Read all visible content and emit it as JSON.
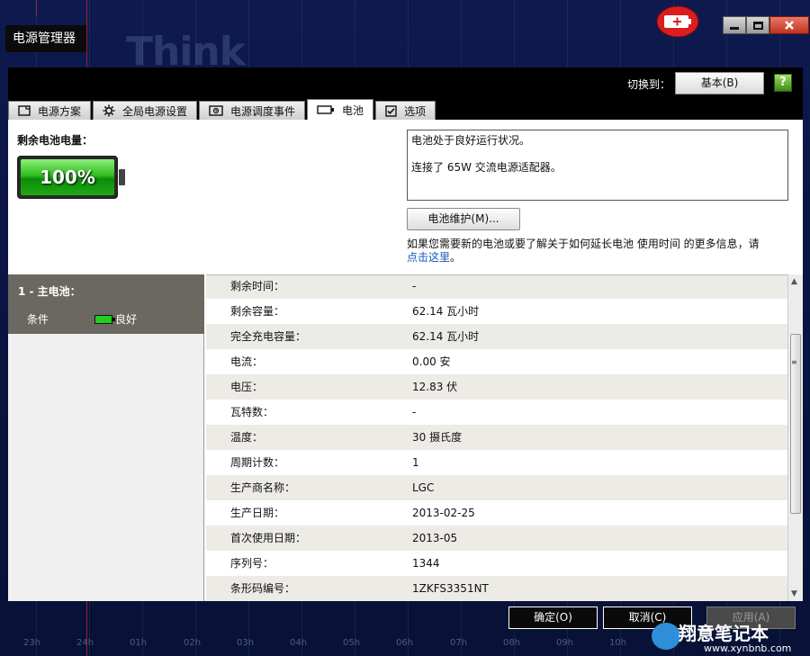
{
  "window": {
    "title": "电源管理器",
    "logo_text": "Think"
  },
  "header": {
    "switch_label": "切换到：",
    "basic_button": "基本(B)",
    "help_icon": "?"
  },
  "tabs": [
    {
      "label": "电源方案",
      "icon": "power-plan-icon"
    },
    {
      "label": "全局电源设置",
      "icon": "gear-icon"
    },
    {
      "label": "电源调度事件",
      "icon": "schedule-icon"
    },
    {
      "label": "电池",
      "icon": "battery-icon",
      "active": true
    },
    {
      "label": "选项",
      "icon": "checkbox-icon"
    }
  ],
  "battery_summary": {
    "remaining_label": "剩余电池电量：",
    "percent_text": "100%",
    "charge_level": 1.0,
    "status_line_1": "电池处于良好运行状况。",
    "status_line_2": "连接了 65W 交流电源适配器。",
    "maintenance_button": "电池维护(M)...",
    "info_text": "如果您需要新的电池或要了解关于如何延长电池 使用时间 的更多信息，请",
    "info_link": "点击这里",
    "info_suffix": "。"
  },
  "battery_list": {
    "name": "1 - 主电池：",
    "condition_label": "条件",
    "condition_value": "良好"
  },
  "details": [
    {
      "key": "剩余时间：",
      "value": "-"
    },
    {
      "key": "剩余容量：",
      "value": "62.14 瓦小时"
    },
    {
      "key": "完全充电容量：",
      "value": "62.14 瓦小时"
    },
    {
      "key": "电流：",
      "value": "0.00 安"
    },
    {
      "key": "电压：",
      "value": "12.83 伏"
    },
    {
      "key": "瓦特数：",
      "value": "-"
    },
    {
      "key": "温度：",
      "value": "30 摄氏度"
    },
    {
      "key": "周期计数：",
      "value": "1"
    },
    {
      "key": "生产商名称：",
      "value": "LGC"
    },
    {
      "key": "生产日期：",
      "value": "2013-02-25"
    },
    {
      "key": "首次使用日期：",
      "value": "2013-05"
    },
    {
      "key": "序列号：",
      "value": "1344"
    },
    {
      "key": "条形码编号：",
      "value": "1ZKFS3351NT"
    }
  ],
  "footer": {
    "ok_button": "确定(O)",
    "cancel_button": "取消(C)",
    "apply_button": "应用(A)"
  },
  "time_axis": [
    "23h",
    "24h",
    "01h",
    "02h",
    "03h",
    "04h",
    "05h",
    "06h",
    "07h",
    "08h",
    "09h",
    "10h"
  ],
  "watermark": {
    "brand": "翔意笔记本",
    "url": "www.xynbnb.com"
  },
  "colors": {
    "battery_green": "#2fbd1e",
    "header_black": "#000000",
    "panel_header": "#6b6862",
    "row_alt": "#edebe6",
    "link": "#1155bb",
    "close_red": "#c0331f"
  }
}
